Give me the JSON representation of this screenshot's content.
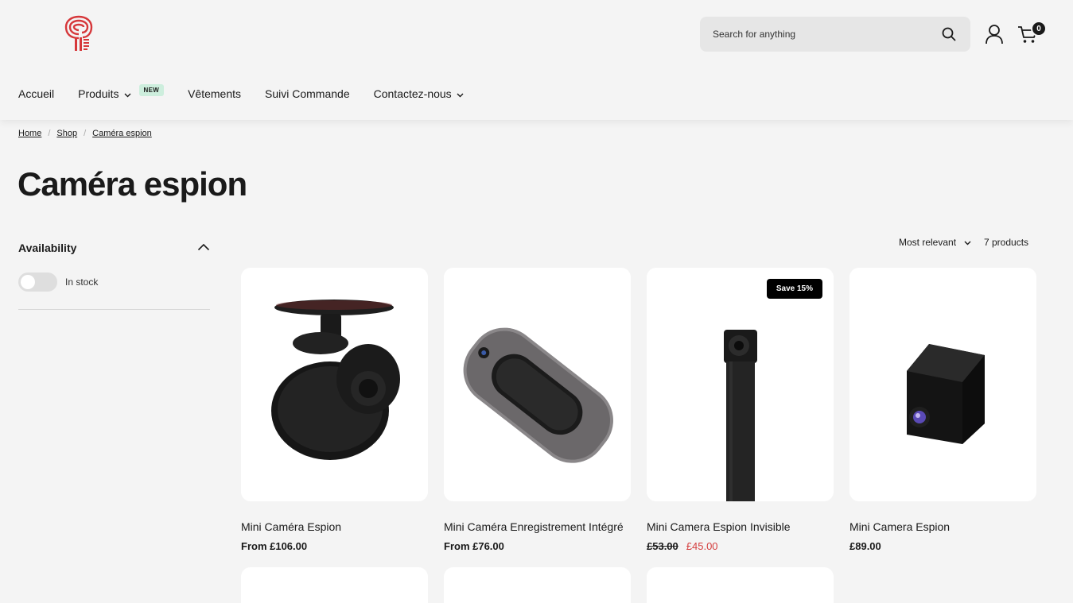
{
  "header": {
    "search_placeholder": "Search for anything",
    "cart_count": "0"
  },
  "nav": {
    "items": [
      {
        "label": "Accueil"
      },
      {
        "label": "Produits",
        "badge": "NEW"
      },
      {
        "label": "Vêtements"
      },
      {
        "label": "Suivi Commande"
      },
      {
        "label": "Contactez-nous"
      }
    ]
  },
  "breadcrumb": [
    "Home",
    "Shop",
    "Caméra espion"
  ],
  "page_title": "Caméra espion",
  "filters": {
    "availability_title": "Availability",
    "in_stock_label": "In stock",
    "in_stock_on": false
  },
  "toolbar": {
    "sort_label": "Most relevant",
    "count_label": "7 products"
  },
  "products": [
    {
      "title": "Mini Caméra Espion",
      "price": "From £106.00"
    },
    {
      "title": "Mini Caméra Enregistrement Intégré",
      "price": "From £76.00"
    },
    {
      "title": "Mini Camera Espion Invisible",
      "old_price": "£53.00",
      "price": "£45.00",
      "badge": "Save 15%"
    },
    {
      "title": "Mini Camera Espion",
      "price": "£89.00"
    }
  ],
  "colors": {
    "background": "#f4f4f4",
    "brand": "#d6373a",
    "sale": "#d43d3d",
    "new_badge": "#cdeedd"
  }
}
